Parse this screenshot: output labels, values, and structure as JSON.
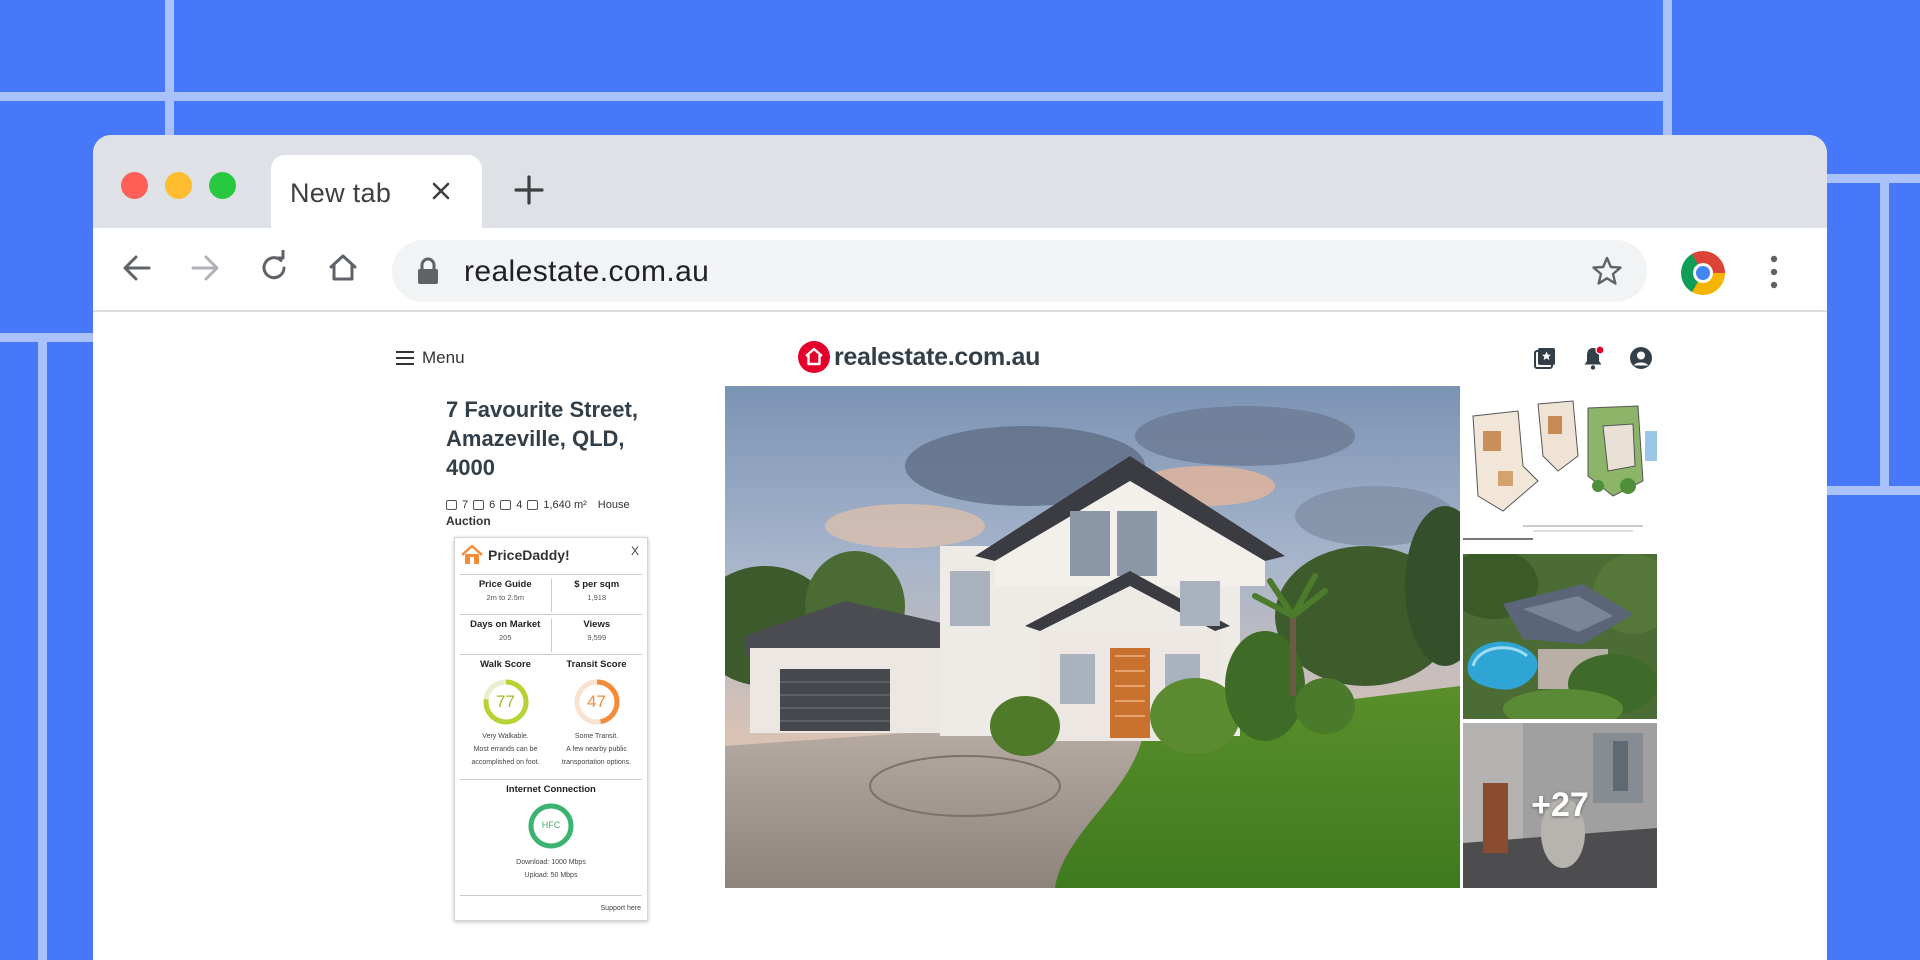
{
  "browser": {
    "tab_title": "New tab",
    "url": "realestate.com.au"
  },
  "site": {
    "menu_label": "Menu",
    "logo_text": "realestate.com.au"
  },
  "listing": {
    "address": "7 Favourite Street, Amazeville, QLD, 4000",
    "bedrooms": "7",
    "bathrooms": "6",
    "parking": "4",
    "land_size": "1,640 m²",
    "property_type": "House",
    "sale_method": "Auction",
    "more_photos": "+27"
  },
  "pricedaddy": {
    "title": "PriceDaddy!",
    "close": "X",
    "price_guide_label": "Price Guide",
    "price_guide_value": "2m to 2.5m",
    "per_sqm_label": "$ per sqm",
    "per_sqm_value": "1,918",
    "days_label": "Days on Market",
    "days_value": "205",
    "views_label": "Views",
    "views_value": "9,599",
    "walk_label": "Walk Score",
    "walk_value": "77",
    "walk_desc_1": "Very Walkable.",
    "walk_desc_2": "Most errands can be",
    "walk_desc_3": "accomplished on foot.",
    "transit_label": "Transit Score",
    "transit_value": "47",
    "transit_desc_1": "Some Transit.",
    "transit_desc_2": "A few nearby public",
    "transit_desc_3": "transportation options.",
    "internet_label": "Internet Connection",
    "internet_value": "HFC",
    "download": "Download: 1000 Mbps",
    "upload": "Upload: 50 Mbps",
    "support": "Support here"
  },
  "colors": {
    "background": "#4678f9",
    "brand_red": "#e4002b",
    "walk_ring": "#b5d334",
    "transit_ring": "#f28c3a",
    "internet_ring": "#3cb371"
  }
}
